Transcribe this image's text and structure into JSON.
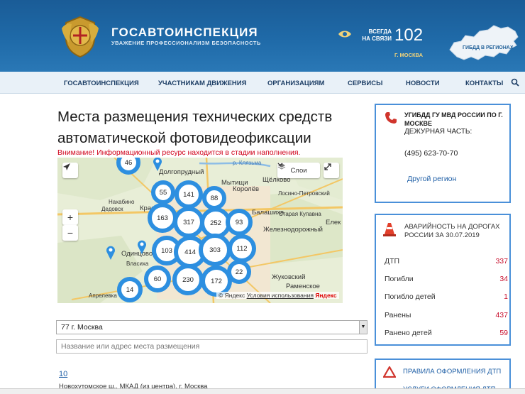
{
  "header": {
    "title": "ГОСАВТОИНСПЕКЦИЯ",
    "subtitle": "УВАЖЕНИЕ ПРОФЕССИОНАЛИЗМ БЕЗОПАСНОСТЬ",
    "contact_label_1": "ВСЕГДА",
    "contact_label_2": "НА СВЯЗИ",
    "contact_number": "102",
    "city": "Г. МОСКВА",
    "regions_label": "ГИБДД В РЕГИОНАХ",
    "colors": {
      "bar": "#1f6aa8",
      "accent": "#f0d27a"
    }
  },
  "nav": {
    "items": [
      "ГОСАВТОИНСПЕКЦИЯ",
      "УЧАСТНИКАМ ДВИЖЕНИЯ",
      "ОРГАНИЗАЦИЯМ",
      "СЕРВИСЫ",
      "НОВОСТИ",
      "КОНТАКТЫ"
    ]
  },
  "main": {
    "title": "Места размещения технических средств автоматической фотовидеофиксации",
    "warning": "Внимание! Информационный ресурс находится в стадии наполнения."
  },
  "map": {
    "layers_label": "Слои",
    "copyright": "© Яндекс",
    "terms": "Условия использования",
    "brand": "Яндекс",
    "place_labels": [
      "Долгопрудный",
      "Мытищи",
      "Щёлково",
      "Королёв",
      "Лосино-Петровский",
      "Нахабино",
      "Дедовск",
      "Красн",
      "Балашиха",
      "Старая Купавна",
      "Железнодорожный",
      "Одинцово",
      "Власиха",
      "Жуковский",
      "Раменское",
      "Апрелевка",
      "р. Клязьма",
      "Елек"
    ],
    "clusters": [
      "46",
      "55",
      "141",
      "88",
      "163",
      "317",
      "252",
      "93",
      "103",
      "414",
      "303",
      "112",
      "60",
      "230",
      "172",
      "22",
      "14"
    ]
  },
  "form": {
    "region_value": "77 г. Москва",
    "search_placeholder": "Название или адрес места размещения"
  },
  "results": {
    "first_number": "10",
    "first_address": "Новохутомское ш., МКАД (из центра), г. Москва"
  },
  "sidebar": {
    "contact": {
      "title": "УГИБДД ГУ МВД РОССИИ ПО Г. МОСКВЕ",
      "duty_label": "ДЕЖУРНАЯ ЧАСТЬ:",
      "phone": "(495) 623-70-70",
      "other_region": "Другой регион"
    },
    "accidents": {
      "title": "АВАРИЙНОСТЬ НА ДОРОГАХ РОССИИ ЗА 30.07.2019",
      "rows": [
        {
          "label": "ДТП",
          "value": "337"
        },
        {
          "label": "Погибли",
          "value": "34"
        },
        {
          "label": "Погибло детей",
          "value": "1"
        },
        {
          "label": "Ранены",
          "value": "437"
        },
        {
          "label": "Ранено детей",
          "value": "59"
        }
      ]
    },
    "rules": {
      "title": "ПРАВИЛА ОФОРМЛЕНИЯ ДТП",
      "sub": "УСЛУГИ ОФОРМЛЕНИЯ ДТП"
    }
  }
}
